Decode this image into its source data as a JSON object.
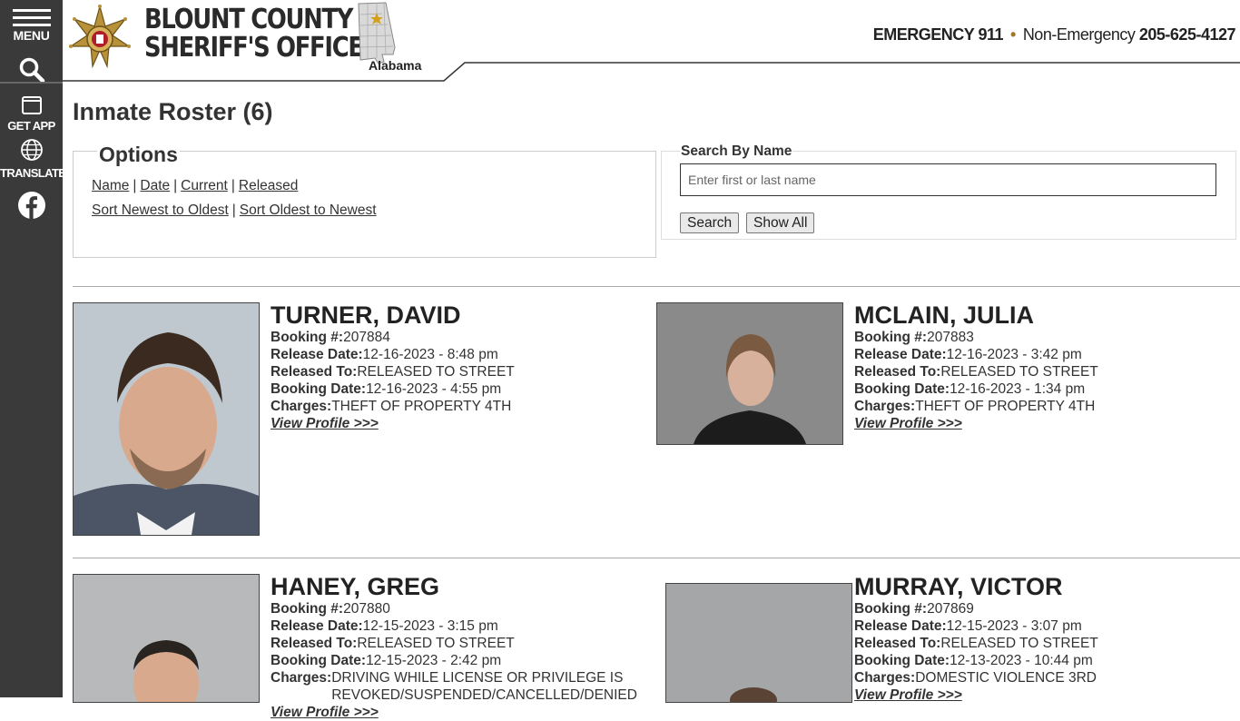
{
  "sidebar": {
    "menu_label": "MENU",
    "app_label": "GET APP",
    "translate_label": "TRANSLATE"
  },
  "header": {
    "title_line1": "BLOUNT COUNTY",
    "title_line2": "SHERIFF'S OFFICE",
    "state": "Alabama",
    "emergency_label": "EMERGENCY 911",
    "non_emergency_label": "Non-Emergency",
    "non_emergency_number": "205-625-4127"
  },
  "page": {
    "title": "Inmate Roster (6)"
  },
  "options": {
    "legend": "Options",
    "links": [
      "Name",
      "Date",
      "Current",
      "Released"
    ],
    "sort_links": [
      "Sort Newest to Oldest",
      "Sort Oldest to Newest"
    ]
  },
  "search": {
    "legend": "Search By Name",
    "placeholder": "Enter first or last name",
    "search_button": "Search",
    "show_all_button": "Show All"
  },
  "labels": {
    "booking": "Booking #:",
    "release_date": "Release Date:",
    "released_to": "Released To:",
    "booking_date": "Booking Date:",
    "charges": "Charges:",
    "view_profile": "View Profile >>>"
  },
  "inmates": [
    {
      "name": "TURNER, DAVID",
      "booking": "207884",
      "release_date": "12-16-2023 - 8:48 pm",
      "released_to": "RELEASED TO STREET",
      "booking_date": "12-16-2023 - 4:55 pm",
      "charges": "THEFT OF PROPERTY 4TH"
    },
    {
      "name": "MCLAIN, JULIA",
      "booking": "207883",
      "release_date": "12-16-2023 - 3:42 pm",
      "released_to": "RELEASED TO STREET",
      "booking_date": "12-16-2023 - 1:34 pm",
      "charges": "THEFT OF PROPERTY 4TH"
    },
    {
      "name": "HANEY, GREG",
      "booking": "207880",
      "release_date": "12-15-2023 - 3:15 pm",
      "released_to": "RELEASED TO STREET",
      "booking_date": "12-15-2023 - 2:42 pm",
      "charges": "DRIVING WHILE LICENSE OR PRIVILEGE IS REVOKED/SUSPENDED/CANCELLED/DENIED"
    },
    {
      "name": "MURRAY, VICTOR",
      "booking": "207869",
      "release_date": "12-15-2023 - 3:07 pm",
      "released_to": "RELEASED TO STREET",
      "booking_date": "12-13-2023 - 10:44 pm",
      "charges": "DOMESTIC VIOLENCE 3RD"
    }
  ],
  "colors": {
    "sidebar": "#3a3a3a",
    "accent_dot": "#a0772c",
    "badge_gold": "#b8923a"
  }
}
